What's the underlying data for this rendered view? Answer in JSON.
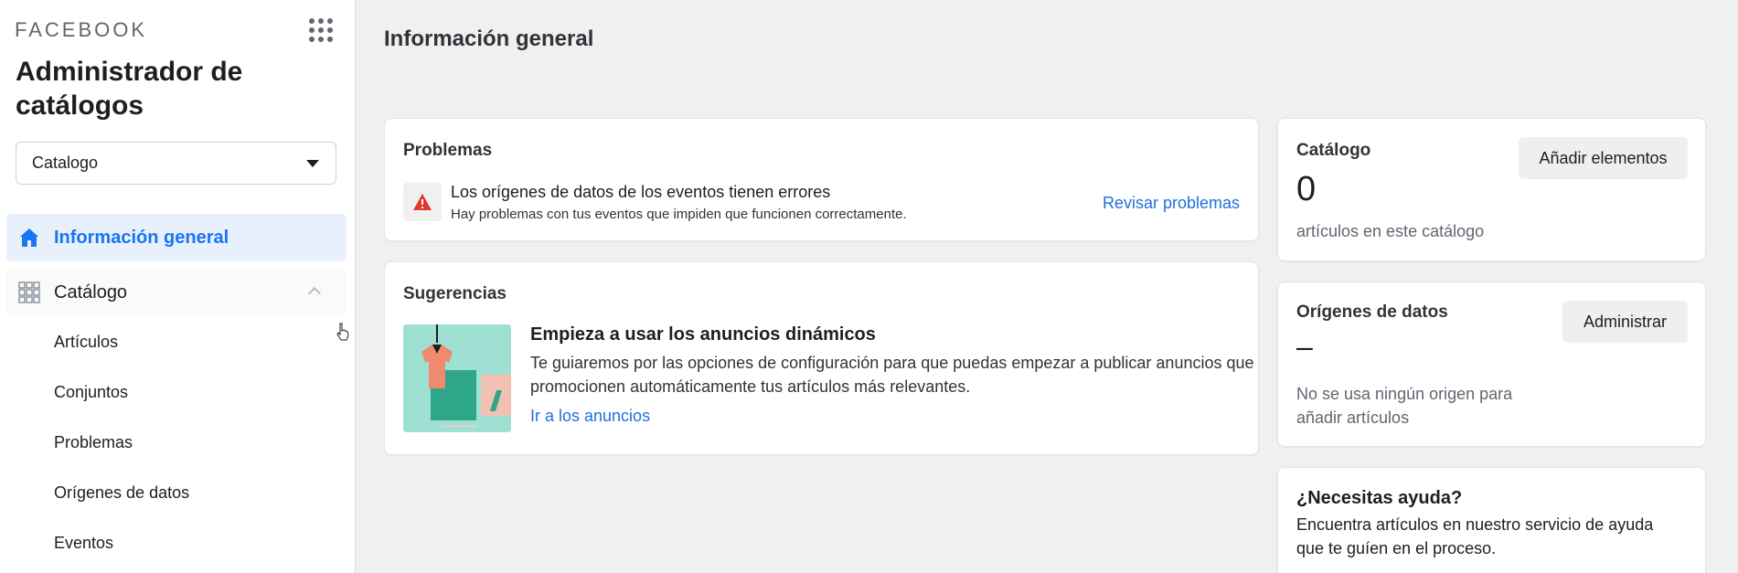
{
  "sidebar": {
    "brand": "FACEBOOK",
    "app_title": "Administrador de catálogos",
    "catalog_select": "Catalogo",
    "nav": {
      "overview": "Información general",
      "catalog": "Catálogo"
    },
    "sub_items": [
      "Artículos",
      "Conjuntos",
      "Problemas",
      "Orígenes de datos",
      "Eventos"
    ]
  },
  "main": {
    "page_title": "Información general",
    "problems": {
      "title": "Problemas",
      "item_title": "Los orígenes de datos de los eventos tienen errores",
      "item_desc": "Hay problemas con tus eventos que impiden que funcionen correctamente.",
      "link": "Revisar problemas"
    },
    "suggestions": {
      "title": "Sugerencias",
      "item_title": "Empieza a usar los anuncios dinámicos",
      "item_desc": "Te guiaremos por las opciones de configuración para que puedas empezar a publicar anuncios que promocionen automáticamente tus artículos más relevantes.",
      "link": "Ir a los anuncios"
    },
    "catalog_card": {
      "title": "Catálogo",
      "count": "0",
      "caption": "artículos en este catálogo",
      "button": "Añadir elementos"
    },
    "sources_card": {
      "title": "Orígenes de datos",
      "value": "–",
      "caption": "No se usa ningún origen para añadir artículos",
      "button": "Administrar"
    },
    "help_card": {
      "title": "¿Necesitas ayuda?",
      "desc": "Encuentra artículos en nuestro servicio de ayuda que te guíen en el proceso."
    }
  },
  "colors": {
    "accent": "#1876f2",
    "link": "#216fdb",
    "warning": "#e0392b"
  }
}
